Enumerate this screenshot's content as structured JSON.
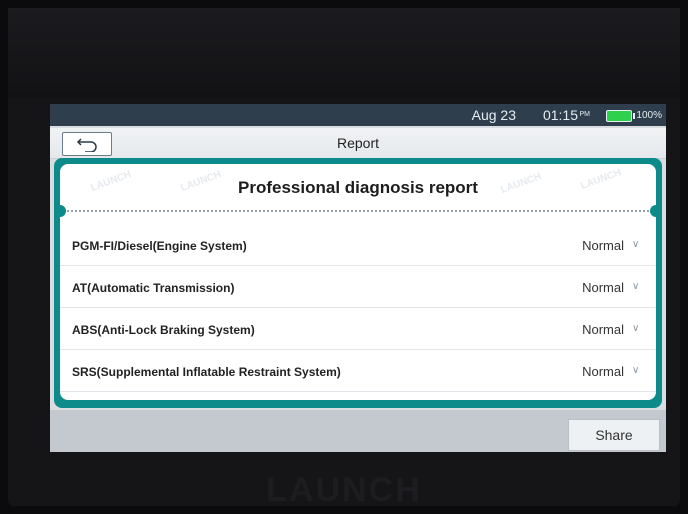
{
  "status_bar": {
    "date": "Aug 23",
    "time": "01:15",
    "period": "PM",
    "battery": "100%"
  },
  "window": {
    "title": "Report",
    "back_icon": "back-arrow-icon"
  },
  "report": {
    "heading": "Professional diagnosis report",
    "watermark": "LAUNCH",
    "systems": [
      {
        "label": "PGM-FI/Diesel(Engine System)",
        "status": "Normal"
      },
      {
        "label": "AT(Automatic Transmission)",
        "status": "Normal"
      },
      {
        "label": "ABS(Anti-Lock Braking System)",
        "status": "Normal"
      },
      {
        "label": "SRS(Supplemental Inflatable Restraint System)",
        "status": "Normal"
      }
    ]
  },
  "footer": {
    "share_label": "Share"
  },
  "device": {
    "brand": "LAUNCH"
  },
  "colors": {
    "accent_teal": "#0d8b8a",
    "status_bar": "#2e3e4c",
    "battery_green": "#2dd14b"
  }
}
